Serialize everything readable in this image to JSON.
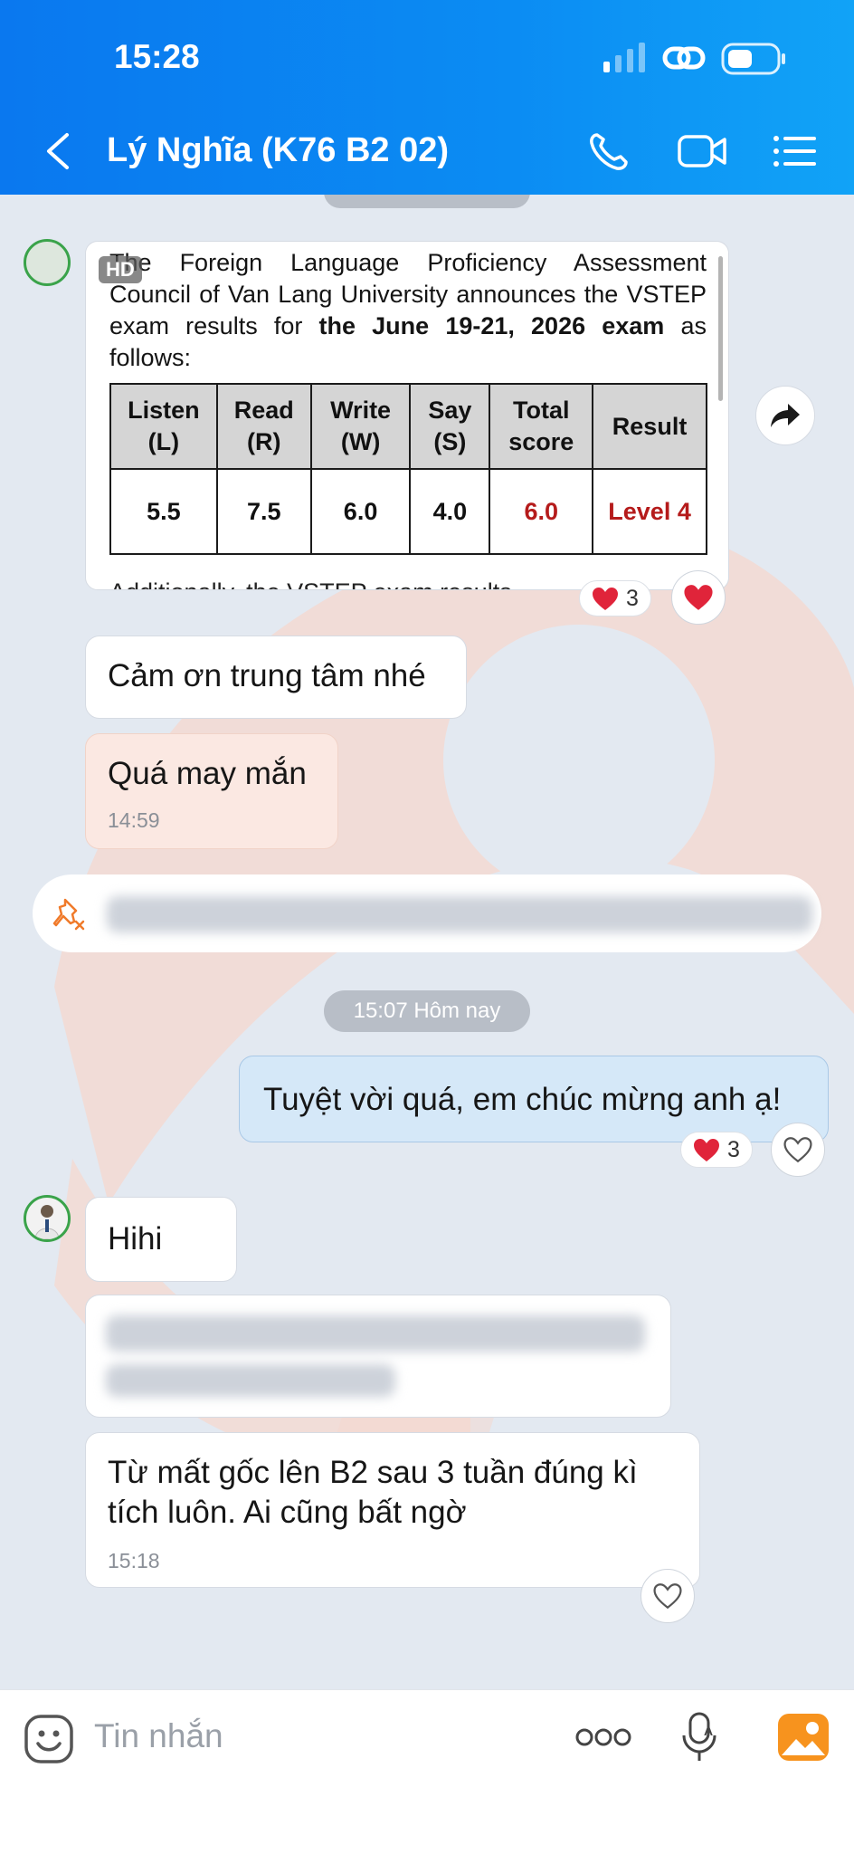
{
  "status_bar": {
    "time": "15:28"
  },
  "header": {
    "title": "Lý Nghĩa (K76 B2 02)"
  },
  "announcement": {
    "hd_badge": "HD",
    "intro_plain": "The Foreign Language Proficiency Assessment Council of Van Lang University announces the VSTEP exam results for ",
    "intro_bold": "the June 19-21, 2026 exam",
    "intro_suffix": " as follows:",
    "headers": [
      "Listen (L)",
      "Read (R)",
      "Write (W)",
      "Say (S)",
      "Total score",
      "Result"
    ],
    "values": [
      "5.5",
      "7.5",
      "6.0",
      "4.0",
      "6.0",
      "Level 4"
    ],
    "cut_text": "Additionally, the VSTEP exam results ...",
    "reaction_count": "3"
  },
  "messages": {
    "thanks": "Cảm ơn trung tâm nhé",
    "lucky": "Quá may mắn",
    "lucky_time": "14:59",
    "date_separator": "15:07 Hôm nay",
    "mine": "Tuyệt vời quá, em chúc mừng anh ạ!",
    "mine_reaction_count": "3",
    "hihi": "Hihi",
    "final": "Từ mất gốc lên B2 sau 3 tuần đúng kì tích luôn. Ai cũng bất ngờ",
    "final_time": "15:18"
  },
  "composer": {
    "placeholder": "Tin nhắn"
  },
  "colors": {
    "header": "#0b8cf3",
    "accent_red": "#b51b1b",
    "heart": "#e0243a",
    "image_icon": "#f7931e"
  }
}
